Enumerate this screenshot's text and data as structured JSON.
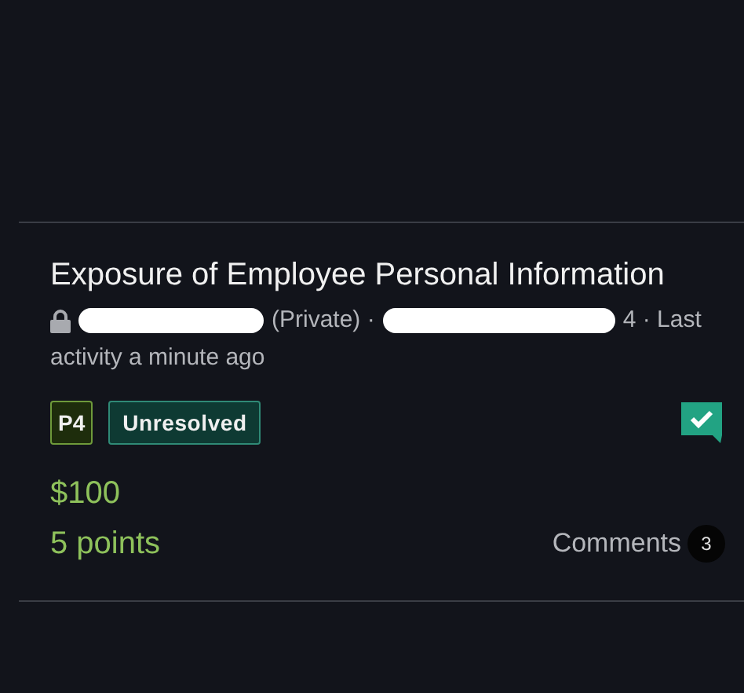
{
  "report": {
    "title": "Exposure of Employee Personal Information",
    "meta": [
      {
        "kind": "lock"
      },
      {
        "kind": "redaction"
      },
      {
        "kind": "text",
        "text": "(Private) ·"
      },
      {
        "kind": "redaction"
      },
      {
        "kind": "text",
        "text": "4 · Last"
      },
      {
        "kind": "text",
        "text": "activity a minute ago"
      }
    ],
    "priority": "P4",
    "status": "Unresolved",
    "bounty": "$100",
    "points": "5 points",
    "comments_label": "Comments",
    "comments_count": "3"
  }
}
